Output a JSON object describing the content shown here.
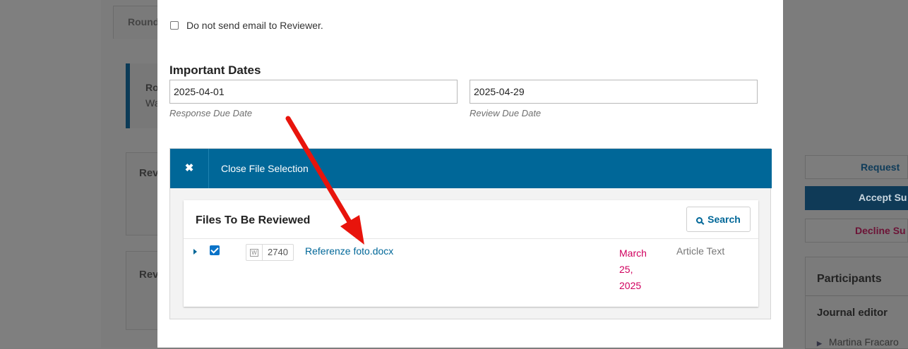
{
  "background": {
    "tab_label": "Round",
    "notice_line1": "Ro",
    "notice_line2": "Wa",
    "box1_label": "Rev",
    "box2_label": "Rev",
    "sidebar": {
      "request_label": "Request",
      "accept_label": "Accept Su",
      "decline_label": "Decline Su",
      "participants_title": "Participants",
      "journal_editor_label": "Journal editor",
      "participant_name": "Martina Fracaro"
    }
  },
  "modal": {
    "no_email_label": "Do not send email to Reviewer.",
    "important_dates_title": "Important Dates",
    "response_due_value": "2025-04-01",
    "response_due_help": "Response Due Date",
    "review_due_value": "2025-04-29",
    "review_due_help": "Review Due Date",
    "file_selection": {
      "close_label": "Close File Selection",
      "card_title": "Files To Be Reviewed",
      "search_label": "Search",
      "files": [
        {
          "id": "2740",
          "name": "Referenze foto.docx",
          "date": "March 25, 2025",
          "type": "Article Text",
          "checked": true
        }
      ]
    }
  },
  "colors": {
    "primary": "#006798",
    "date_accent": "#d0005e",
    "annotation_arrow": "#e8140c"
  }
}
